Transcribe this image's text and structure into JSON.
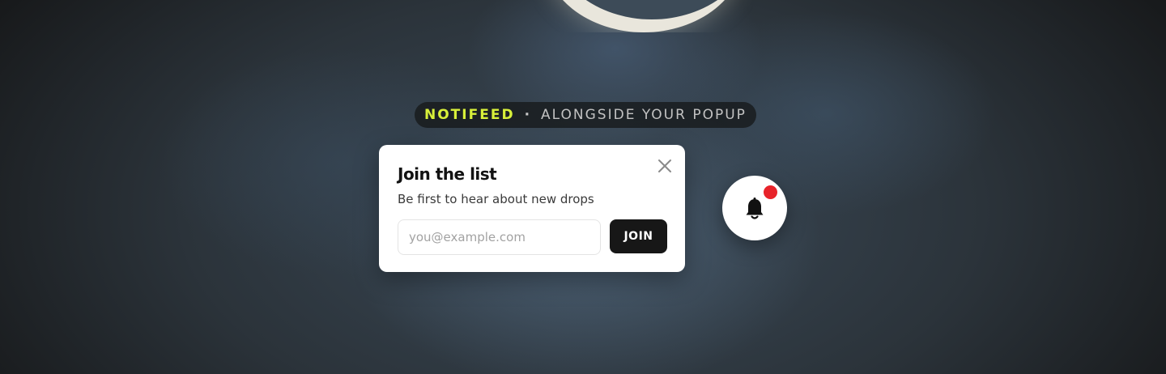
{
  "eyebrow": {
    "brand": "NOTIFEED",
    "separator": "·",
    "tagline": "ALONGSIDE YOUR POPUP"
  },
  "popup": {
    "title": "Join the list",
    "subtitle": "Be first to hear about new drops",
    "email_placeholder": "you@example.com",
    "email_value": "",
    "join_label": "JOIN",
    "close_icon": "close-icon"
  },
  "launcher": {
    "icon": "bell-icon",
    "has_unread_indicator": true
  },
  "colors": {
    "brand_accent": "#d8f03a",
    "button_dark": "#171717",
    "notification_red": "#e8232a",
    "card_background": "#ffffff"
  }
}
